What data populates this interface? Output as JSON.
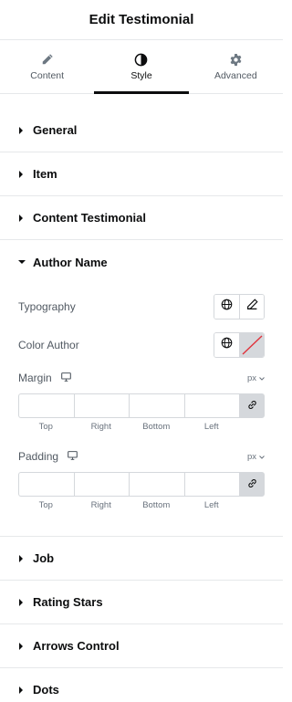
{
  "header": {
    "title": "Edit Testimonial"
  },
  "tabs": [
    {
      "label": "Content",
      "icon": "pencil-icon",
      "active": false
    },
    {
      "label": "Style",
      "icon": "contrast-icon",
      "active": true
    },
    {
      "label": "Advanced",
      "icon": "gear-icon",
      "active": false
    }
  ],
  "sections_before": [
    {
      "label": "General"
    },
    {
      "label": "Item"
    },
    {
      "label": "Content Testimonial"
    }
  ],
  "author_name": {
    "label": "Author Name",
    "typography": {
      "label": "Typography",
      "icons": [
        "globe-icon",
        "pencil-icon"
      ]
    },
    "color_author": {
      "label": "Color Author",
      "icons": [
        "globe-icon",
        "color-swatch-empty"
      ]
    },
    "margin": {
      "label": "Margin",
      "unit": "px",
      "values": {
        "top": "",
        "right": "",
        "bottom": "",
        "left": ""
      },
      "side_labels": {
        "top": "Top",
        "right": "Right",
        "bottom": "Bottom",
        "left": "Left"
      }
    },
    "padding": {
      "label": "Padding",
      "unit": "px",
      "values": {
        "top": "",
        "right": "",
        "bottom": "",
        "left": ""
      },
      "side_labels": {
        "top": "Top",
        "right": "Right",
        "bottom": "Bottom",
        "left": "Left"
      }
    }
  },
  "sections_after": [
    {
      "label": "Job"
    },
    {
      "label": "Rating Stars"
    },
    {
      "label": "Arrows Control"
    },
    {
      "label": "Dots"
    }
  ]
}
